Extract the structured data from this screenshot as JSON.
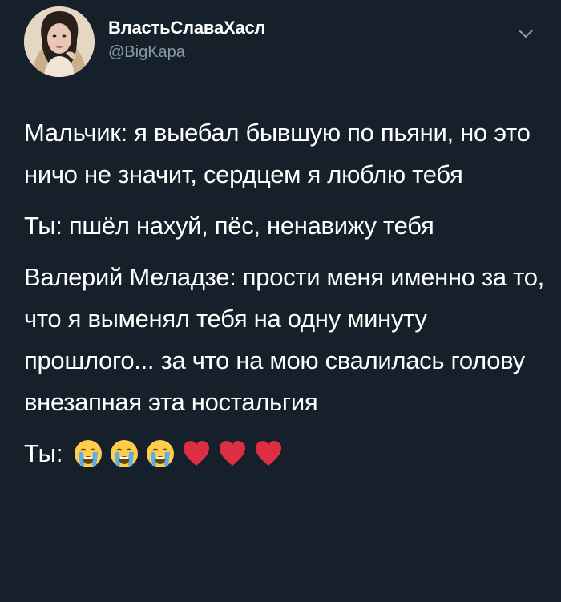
{
  "author": {
    "display_name": "ВластьСлаваХасл",
    "handle": "@BigKapa"
  },
  "tweet": {
    "paragraphs": [
      "Мальчик: я выебал бывшую по пьяни, но это ничо не значит, сердцем я люблю тебя",
      "Ты: пшёл нахуй, пёс, ненавижу тебя",
      "Валерий Меладзе: прости меня именно за то, что я выменял тебя на одну минуту прошлого... за что на мою свалилась голову внезапная эта ностальгия"
    ],
    "final_line": {
      "prefix": "Ты:",
      "emojis": [
        "crying-face",
        "crying-face",
        "crying-face",
        "red-heart",
        "red-heart",
        "red-heart"
      ]
    }
  },
  "colors": {
    "background": "#15202b",
    "text": "#ffffff",
    "secondary_text": "#8899a6"
  },
  "icons": {
    "more": "chevron-down-icon"
  }
}
